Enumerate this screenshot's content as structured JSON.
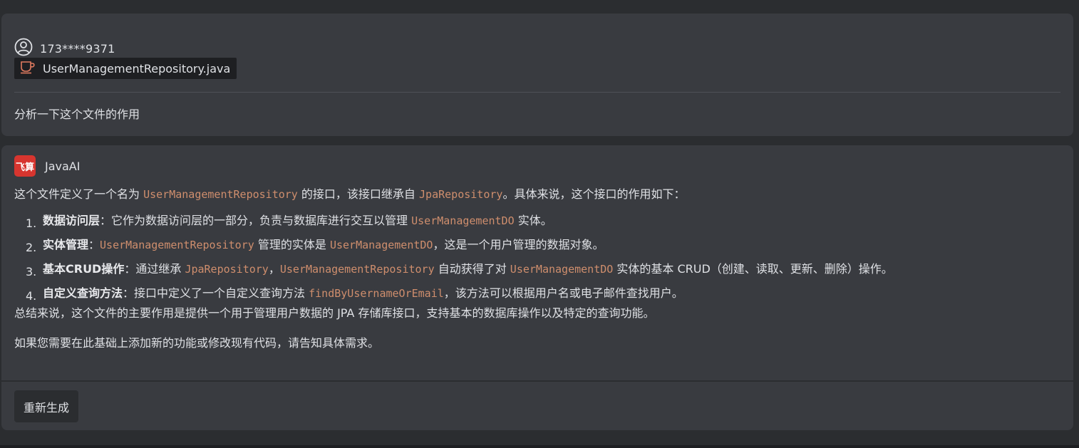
{
  "user": {
    "icon": "user-circle-icon",
    "name": "173****9371",
    "file_icon": "java-coffee-cup-icon",
    "file_name": "UserManagementRepository.java",
    "question": "分析一下这个文件的作用"
  },
  "ai": {
    "logo_text": "飞算",
    "name": "JavaAI",
    "intro": {
      "p1": "这个文件定义了一个名为 ",
      "c1": "UserManagementRepository",
      "p2": " 的接口，该接口继承自 ",
      "c2": "JpaRepository",
      "p3": "。具体来说，这个接口的作用如下："
    },
    "items": [
      {
        "num": "1.",
        "title": "数据访问层",
        "t1": "：它作为数据访问层的一部分，负责与数据库进行交互以管理 ",
        "c1": "UserManagementDO",
        "t2": " 实体。"
      },
      {
        "num": "2.",
        "title": "实体管理",
        "t1": "：",
        "c1": "UserManagementRepository",
        "t2": " 管理的实体是 ",
        "c2": "UserManagementDO",
        "t3": "，这是一个用户管理的数据对象。"
      },
      {
        "num": "3.",
        "title": "基本CRUD操作",
        "t1": "：通过继承 ",
        "c1": "JpaRepository",
        "t2": "，",
        "c2": "UserManagementRepository",
        "t3": " 自动获得了对 ",
        "c3": "UserManagementDO",
        "t4": " 实体的基本 CRUD（创建、读取、更新、删除）操作。"
      },
      {
        "num": "4.",
        "title": "自定义查询方法",
        "t1": "：接口中定义了一个自定义查询方法 ",
        "c1": "findByUsernameOrEmail",
        "t2": "，该方法可以根据用户名或电子邮件查找用户。"
      }
    ],
    "summary": "总结来说，这个文件的主要作用是提供一个用于管理用户数据的 JPA 存储库接口，支持基本的数据库操作以及特定的查询功能。",
    "closing": "如果您需要在此基础上添加新的功能或修改现有代码，请告知具体需求。",
    "regenerate_label": "重新生成"
  },
  "colors": {
    "background": "#2b2d30",
    "card": "#393b40",
    "code": "#cf8e6d",
    "logo": "#d7352f",
    "java_icon": "#e07a5f"
  }
}
